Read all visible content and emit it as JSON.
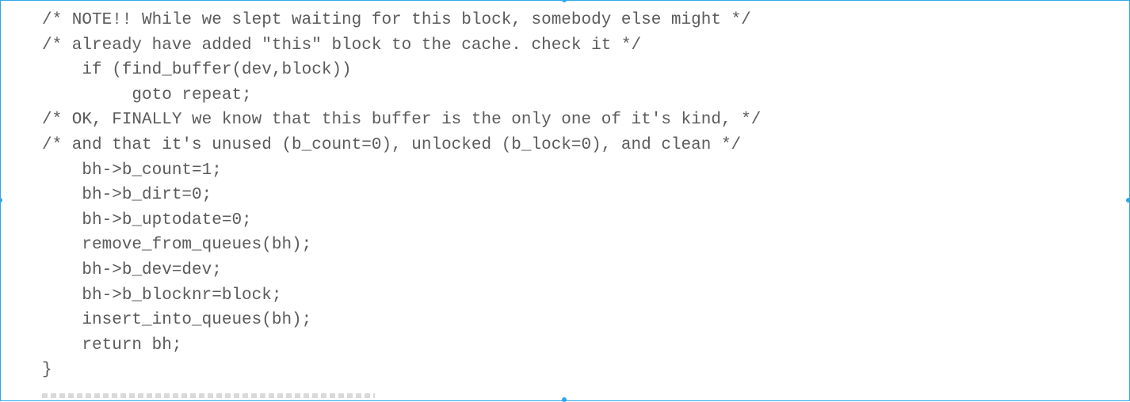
{
  "code": {
    "lines": [
      "/* NOTE!! While we slept waiting for this block, somebody else might */",
      "/* already have added \"this\" block to the cache. check it */",
      "    if (find_buffer(dev,block))",
      "         goto repeat;",
      "/* OK, FINALLY we know that this buffer is the only one of it's kind, */",
      "/* and that it's unused (b_count=0), unlocked (b_lock=0), and clean */",
      "    bh->b_count=1;",
      "    bh->b_dirt=0;",
      "    bh->b_uptodate=0;",
      "    remove_from_queues(bh);",
      "    bh->b_dev=dev;",
      "    bh->b_blocknr=block;",
      "    insert_into_queues(bh);",
      "    return bh;",
      "}"
    ]
  },
  "colors": {
    "text": "#5b5b5b",
    "selection_border": "#2fa7e8"
  }
}
